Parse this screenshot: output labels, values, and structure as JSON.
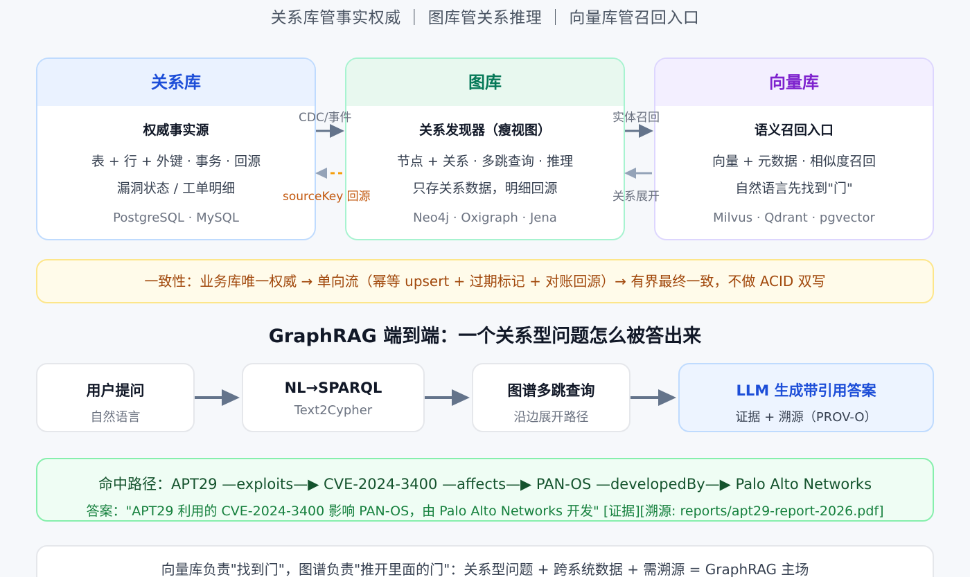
{
  "top_title": "关系库管事实权威 ｜ 图库管关系推理 ｜ 向量库管召回入口",
  "stores": [
    {
      "name": "关系库",
      "role": "权威事实源",
      "line1": "表 + 行 + 外键 · 事务 · 回源",
      "line2": "漏洞状态 / 工单明细",
      "tech": "PostgreSQL · MySQL"
    },
    {
      "name": "图库",
      "role": "关系发现器（瘦视图）",
      "line1": "节点 + 关系 · 多跳查询 · 推理",
      "line2": "只存关系数据，明细回源",
      "tech": "Neo4j · Oxigraph · Jena"
    },
    {
      "name": "向量库",
      "role": "语义召回入口",
      "line1": "向量 + 元数据 · 相似度召回",
      "line2": "自然语言先找到\"门\"",
      "tech": "Milvus · Qdrant · pgvector"
    }
  ],
  "edges": {
    "cdc": "CDC/事件",
    "source_key": "sourceKey 回源",
    "entity_recall": "实体召回",
    "relation_expand": "关系展开"
  },
  "colors": {
    "relational": "#1d4ed8",
    "graph": "#047857",
    "vector": "#7e22ce",
    "arrow": "#64748b",
    "dashed_arrow": "#f59e0b"
  },
  "consistency": "一致性：业务库唯一权威 → 单向流（幂等 upsert + 过期标记 + 对账回源）→ 有界最终一致，不做 ACID 双写",
  "section_title": "GraphRAG 端到端：一个关系型问题怎么被答出来",
  "pipeline": [
    {
      "title": "用户提问",
      "subtitle": "自然语言"
    },
    {
      "title": "NL→SPARQL",
      "subtitle": "Text2Cypher"
    },
    {
      "title": "图谱多跳查询",
      "subtitle": "沿边展开路径"
    },
    {
      "title": "LLM 生成带引用答案",
      "subtitle": "证据 + 溯源（PROV-O）"
    }
  ],
  "hit_path": "命中路径：APT29 —exploits—▶ CVE-2024-3400 —affects—▶ PAN-OS —developedBy—▶ Palo Alto Networks",
  "answer": "答案：\"APT29 利用的 CVE-2024-3400 影响 PAN-OS，由 Palo Alto Networks 开发\" [证据][溯源: reports/apt29-report-2026.pdf]",
  "summary": "向量库负责\"找到门\"，图谱负责\"推开里面的门\"：关系型问题 + 跨系统数据 + 需溯源 = GraphRAG 主场"
}
